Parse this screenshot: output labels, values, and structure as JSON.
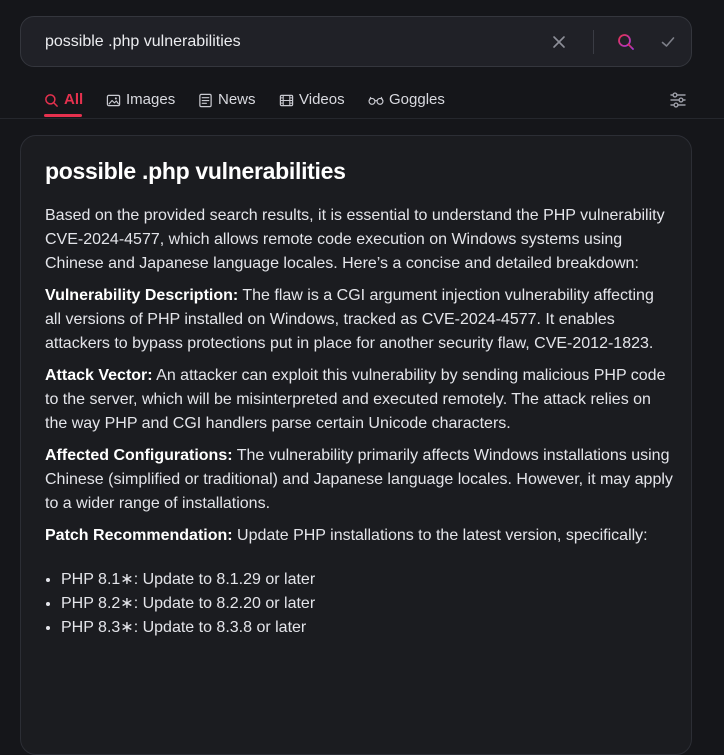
{
  "search": {
    "query": "possible .php vulnerabilities"
  },
  "tabs": [
    {
      "label": "All",
      "icon": "search-icon",
      "active": true
    },
    {
      "label": "Images",
      "icon": "image-icon"
    },
    {
      "label": "News",
      "icon": "news-icon"
    },
    {
      "label": "Videos",
      "icon": "film-icon"
    },
    {
      "label": "Goggles",
      "icon": "goggles-icon"
    }
  ],
  "colors": {
    "accent": "#e5314e",
    "background": "#15161a",
    "card": "#1b1c20"
  },
  "answer": {
    "title": "possible .php vulnerabilities",
    "intro": "Based on the provided search results, it is essential to understand the PHP vulnerability CVE-2024-4577, which allows remote code execution on Windows systems using Chinese and Japanese language locales. Here’s a concise and detailed breakdown:",
    "sections": [
      {
        "heading": "Vulnerability Description:",
        "text": " The flaw is a CGI argument injection vulnerability affecting all versions of PHP installed on Windows, tracked as CVE-2024-4577. It enables attackers to bypass protections put in place for another security flaw, CVE-2012-1823."
      },
      {
        "heading": "Attack Vector:",
        "text": " An attacker can exploit this vulnerability by sending malicious PHP code to the server, which will be misinterpreted and executed remotely. The attack relies on the way PHP and CGI handlers parse certain Unicode characters."
      },
      {
        "heading": "Affected Configurations:",
        "text": " The vulnerability primarily affects Windows installations using Chinese (simplified or traditional) and Japanese language locales. However, it may apply to a wider range of installations."
      },
      {
        "heading": "Patch Recommendation:",
        "text": " Update PHP installations to the latest version, specifically:"
      }
    ],
    "patches": [
      "PHP 8.1∗: Update to 8.1.29 or later",
      "PHP 8.2∗: Update to 8.2.20 or later",
      "PHP 8.3∗: Update to 8.3.8 or later"
    ]
  }
}
